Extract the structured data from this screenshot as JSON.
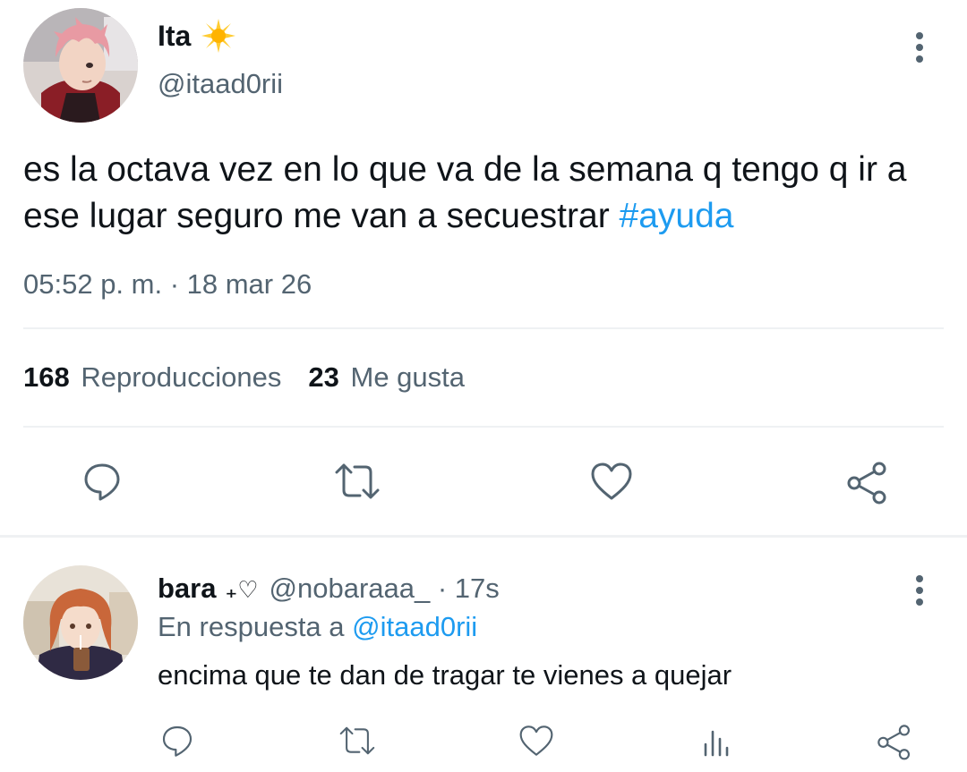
{
  "main_tweet": {
    "author_name": "Ita",
    "badge_emoji": "☀️",
    "handle": "@itaad0rii",
    "text": "es la octava vez en lo que va de la semana q tengo q ir a ese lugar seguro me van a secuestrar ",
    "hashtag": "#ayuda",
    "timestamp": "05:52 p. m. · 18 mar 26",
    "views_count": "168",
    "views_label": "Reproducciones",
    "likes_count": "23",
    "likes_label": "Me gusta",
    "avatar_icon": "anime-boy-avatar",
    "actions": [
      "reply-icon",
      "retweet-icon",
      "like-icon",
      "share-icon"
    ]
  },
  "reply": {
    "author_name": "bara",
    "author_suffix": "₊♡",
    "handle_time": "@nobaraaa_ · 17s",
    "replying_prefix": "En respuesta a ",
    "replying_to": "@itaad0rii",
    "text": "encima que te dan de tragar te vienes a quejar",
    "avatar_icon": "anime-girl-avatar",
    "actions": [
      "reply-icon",
      "retweet-icon",
      "like-icon",
      "analytics-icon",
      "share-icon"
    ]
  },
  "colors": {
    "text": "#0f1419",
    "muted": "#536471",
    "link": "#1d9bf0",
    "divider": "#eff1f3"
  }
}
